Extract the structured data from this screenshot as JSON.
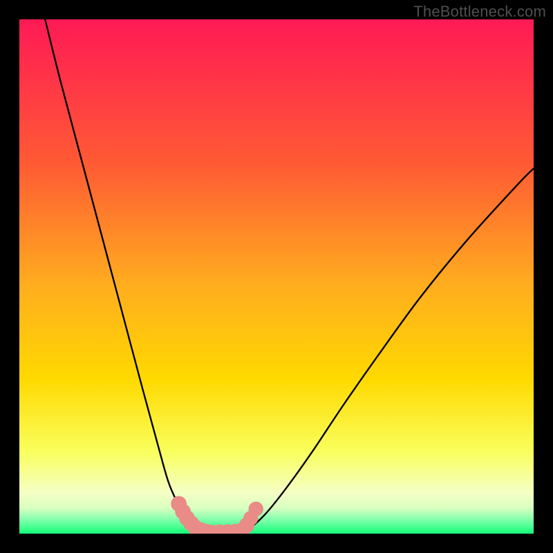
{
  "watermark": "TheBottleneck.com",
  "colors": {
    "page_bg": "#000000",
    "gradient_top": "#ff1a55",
    "gradient_mid1": "#ff6d2b",
    "gradient_mid2": "#ffd900",
    "gradient_mid3": "#f9ff5c",
    "gradient_bottom_band": "#f5ffc4",
    "gradient_bottom": "#13ff7a",
    "curve": "#000000",
    "marker_fill": "#e98b86",
    "marker_stroke": "#d86a65",
    "watermark_color": "#4f4f4f"
  },
  "chart_data": {
    "type": "line",
    "title": "",
    "xlabel": "",
    "ylabel": "",
    "xlim": [
      0,
      100
    ],
    "ylim": [
      0,
      100
    ],
    "grid": false,
    "legend": false,
    "annotations": [
      "TheBottleneck.com"
    ],
    "series": [
      {
        "name": "left-curve",
        "x": [
          5,
          8,
          12,
          16,
          20,
          24,
          27,
          29,
          31,
          32.5,
          34,
          35.5,
          37
        ],
        "y": [
          100,
          88,
          73,
          58,
          43,
          28,
          17,
          10,
          5.5,
          3.2,
          1.6,
          0.6,
          0.2
        ]
      },
      {
        "name": "right-curve",
        "x": [
          43,
          45,
          48,
          52,
          57,
          63,
          70,
          78,
          87,
          97,
          100
        ],
        "y": [
          0.2,
          1.2,
          4,
          9,
          16,
          25,
          35,
          46,
          57,
          68,
          71
        ]
      },
      {
        "name": "valley-floor",
        "x": [
          37,
          38.5,
          40,
          41.5,
          43
        ],
        "y": [
          0.2,
          0.05,
          0.0,
          0.05,
          0.2
        ]
      }
    ],
    "markers": [
      {
        "x": 31.0,
        "y": 5.8,
        "r": 1.1
      },
      {
        "x": 31.8,
        "y": 4.3,
        "r": 1.1
      },
      {
        "x": 32.6,
        "y": 3.0,
        "r": 1.1
      },
      {
        "x": 33.4,
        "y": 2.0,
        "r": 1.1
      },
      {
        "x": 34.2,
        "y": 1.2,
        "r": 1.1
      },
      {
        "x": 35.2,
        "y": 0.7,
        "r": 1.1
      },
      {
        "x": 36.3,
        "y": 0.4,
        "r": 1.1
      },
      {
        "x": 37.5,
        "y": 0.2,
        "r": 1.1
      },
      {
        "x": 39.0,
        "y": 0.1,
        "r": 1.3
      },
      {
        "x": 40.5,
        "y": 0.1,
        "r": 1.3
      },
      {
        "x": 42.0,
        "y": 0.2,
        "r": 1.3
      },
      {
        "x": 43.2,
        "y": 0.6,
        "r": 1.1
      },
      {
        "x": 44.2,
        "y": 1.6,
        "r": 1.1
      },
      {
        "x": 45.0,
        "y": 3.0,
        "r": 1.0
      },
      {
        "x": 46.0,
        "y": 4.8,
        "r": 1.0
      }
    ]
  }
}
